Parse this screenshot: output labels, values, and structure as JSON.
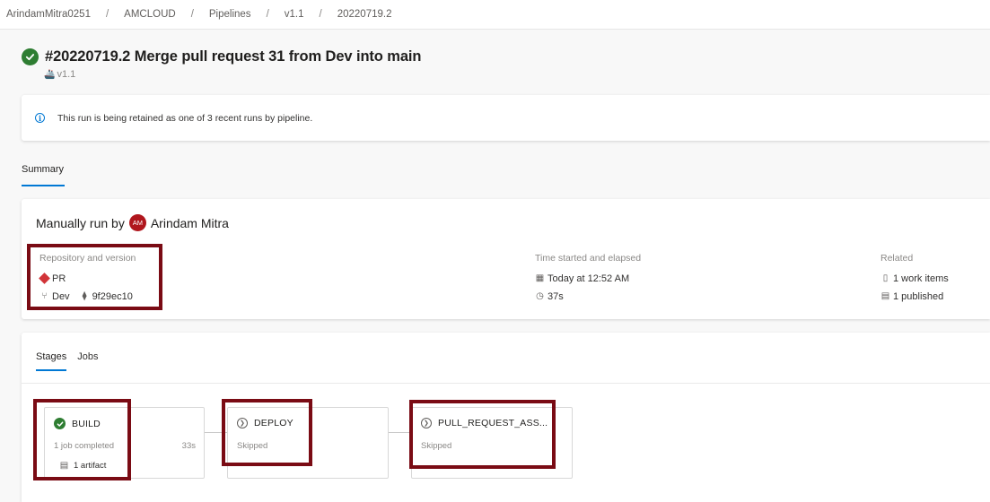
{
  "breadcrumb": [
    "ArindamMitra0251",
    "AMCLOUD",
    "Pipelines",
    "v1.1",
    "20220719.2"
  ],
  "run": {
    "title": "#20220719.2 Merge pull request 31 from Dev into main",
    "pipeline": "v1.1"
  },
  "banner": {
    "message": "This run is being retained as one of 3 recent runs by pipeline."
  },
  "tabs": {
    "summary": "Summary"
  },
  "summary": {
    "run_by_prefix": "Manually run by",
    "avatar_initials": "AM",
    "user": "Arindam Mitra",
    "repository": {
      "label": "Repository and version",
      "repo": "PR",
      "branch": "Dev",
      "commit": "9f29ec10"
    },
    "time": {
      "label": "Time started and elapsed",
      "started": "Today at 12:52 AM",
      "elapsed": "37s"
    },
    "related": {
      "label": "Related",
      "work_items": "1 work items",
      "published": "1 published"
    }
  },
  "stages_section": {
    "tabs": [
      "Stages",
      "Jobs"
    ],
    "stages": [
      {
        "name": "BUILD",
        "status": "succeeded",
        "meta": "1 job completed",
        "duration": "33s",
        "artifact": "1 artifact"
      },
      {
        "name": "DEPLOY",
        "status": "skipped",
        "meta": "Skipped"
      },
      {
        "name": "PULL_REQUEST_ASS...",
        "status": "skipped",
        "meta": "Skipped"
      }
    ]
  },
  "colors": {
    "accent": "#0078d4",
    "success": "#2e7d32",
    "highlight_box": "#7a0b14",
    "avatar": "#b0161d"
  }
}
